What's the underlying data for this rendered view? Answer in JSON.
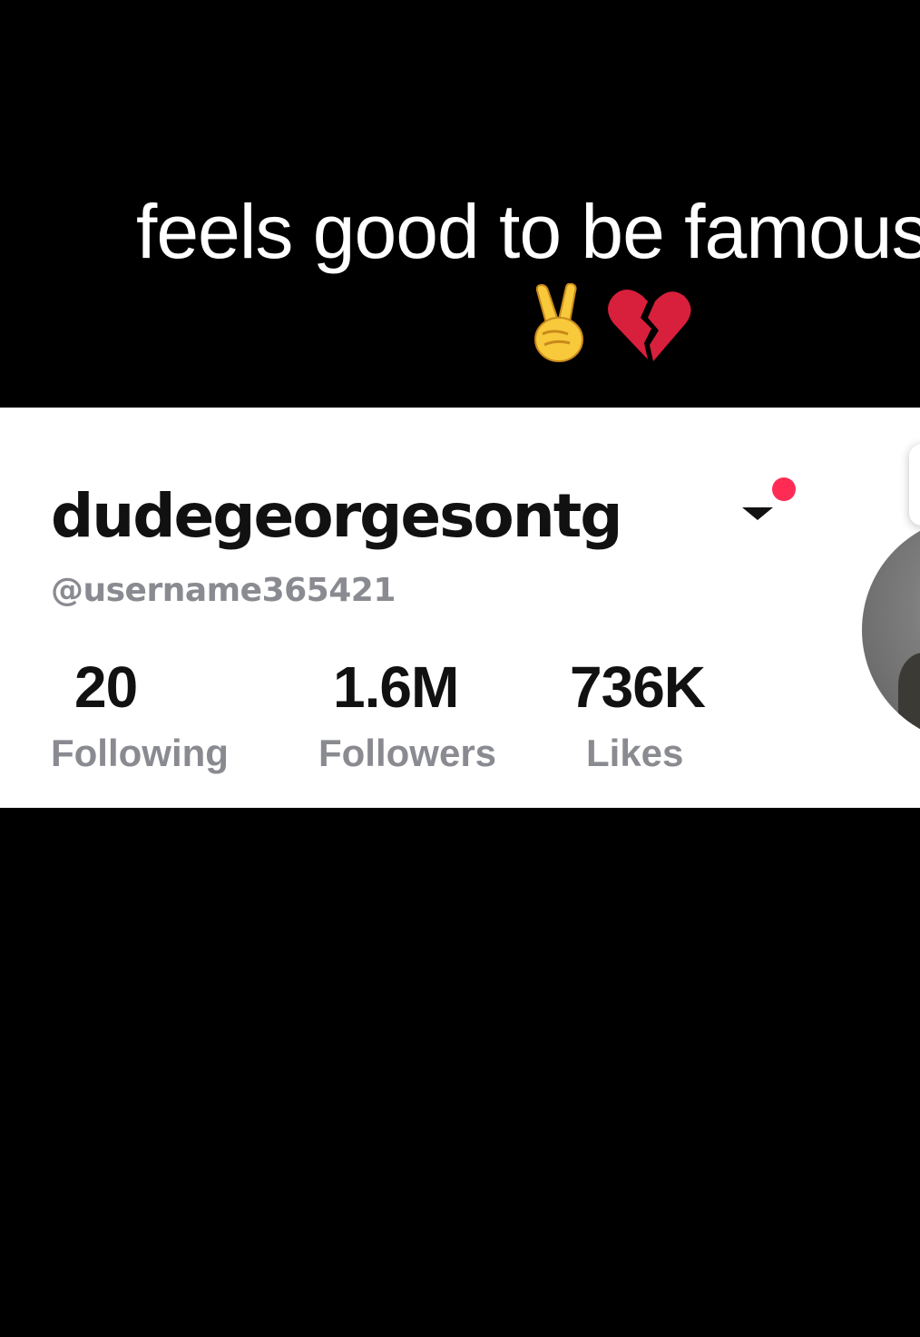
{
  "caption": {
    "text": "feels good to be famous",
    "emoji_icons": [
      "victory-hand-icon",
      "broken-heart-icon"
    ]
  },
  "profile": {
    "display_name": "dudegeorgesontg",
    "username": "@username365421",
    "switch_account_icon": "chevron-down-icon",
    "notification_dot_color": "#fe2c55",
    "stats": [
      {
        "value": "20",
        "label": "Following"
      },
      {
        "value": "1.6M",
        "label": "Followers"
      },
      {
        "value": "736K",
        "label": "Likes"
      }
    ]
  },
  "colors": {
    "background": "#000000",
    "card": "#ffffff",
    "primary_text": "#111111",
    "secondary_text": "#8a8b91",
    "accent": "#fe2c55"
  }
}
